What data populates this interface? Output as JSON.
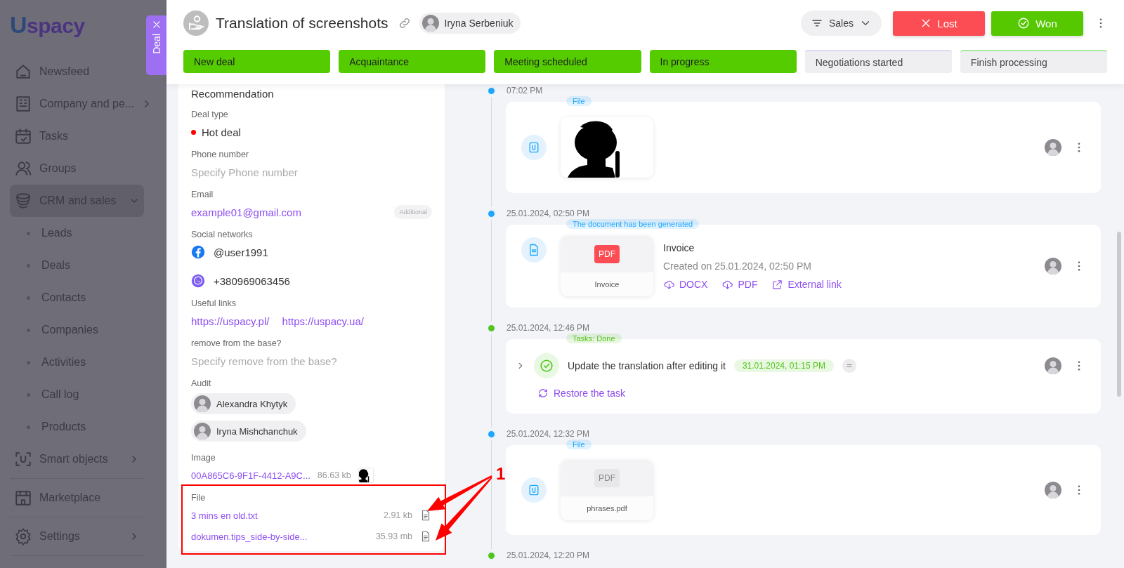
{
  "sidebar": {
    "logo": "Uspacy",
    "sections": [
      [
        {
          "label": "Newsfeed",
          "selected": false
        },
        {
          "label": "Company and pe...",
          "selected": false,
          "expanded": false
        },
        {
          "label": "Tasks",
          "selected": false
        },
        {
          "label": "Groups",
          "selected": false
        },
        {
          "label": "CRM and sales",
          "selected": true,
          "expanded": true,
          "children": [
            {
              "label": "Leads",
              "selected": false
            },
            {
              "label": "Deals",
              "selected": false
            },
            {
              "label": "Contacts",
              "selected": false
            },
            {
              "label": "Companies",
              "selected": false
            },
            {
              "label": "Activities",
              "selected": false
            },
            {
              "label": "Call log",
              "selected": false
            },
            {
              "label": "Products",
              "selected": false
            }
          ]
        },
        {
          "label": "Smart objects",
          "selected": false,
          "expanded": false
        }
      ],
      [
        {
          "label": "Marketplace",
          "selected": false
        }
      ],
      [
        {
          "label": "Settings",
          "selected": false,
          "expanded": false
        }
      ]
    ]
  },
  "deal_tab": {
    "label": "Deal"
  },
  "header": {
    "title": "Translation of screenshots",
    "owner": "Iryna Serbeniuk",
    "pipeline": "Sales",
    "lost_button": "Lost",
    "won_button": "Won"
  },
  "stages": [
    {
      "label": "New deal",
      "done": true,
      "color": "#55cc00"
    },
    {
      "label": "Acquaintance",
      "done": true,
      "color": "#55cc00"
    },
    {
      "label": "Meeting scheduled",
      "done": true,
      "color": "#55cc00"
    },
    {
      "label": "In progress",
      "done": true,
      "color": "#55cc00"
    },
    {
      "label": "Negotiations started",
      "done": false,
      "color": "#e2d6f7"
    },
    {
      "label": "Finish processing",
      "done": false,
      "color": "#a8e69c"
    }
  ],
  "fields": [
    {
      "kind": "value",
      "value": "Recommendation"
    },
    {
      "kind": "tag",
      "label": "Deal type",
      "value": "Hot deal",
      "color": "#ff0000"
    },
    {
      "kind": "empty",
      "label": "Phone number",
      "placeholder": "Specify Phone number"
    },
    {
      "kind": "email",
      "label": "Email",
      "value": "example01@gmail.com",
      "badge": "Additional"
    },
    {
      "kind": "social",
      "label": "Social networks",
      "entries": [
        {
          "kind": "facebook",
          "value": "@user1991"
        },
        {
          "kind": "viber",
          "value": "+380969063456"
        }
      ]
    },
    {
      "kind": "links",
      "label": "Useful links",
      "links": [
        "https://uspacy.pl/",
        "https://uspacy.ua/"
      ]
    },
    {
      "kind": "empty",
      "label": "remove from the base?",
      "placeholder": "Specify remove from the base?"
    },
    {
      "kind": "people",
      "label": "Audit",
      "people": [
        "Alexandra Khytyk",
        "Iryna Mishchanchuk"
      ]
    },
    {
      "label": "Image",
      "name": "00A865C6-9F1F-4412-A9C...",
      "size": "86.63 kb"
    },
    {
      "kind": "files",
      "label": "File",
      "files": [
        {
          "name": "3 mins en old.txt",
          "size": "2.91 kb"
        },
        {
          "name": "dokumen.tips_side-by-side...",
          "size": "35.93 mb"
        }
      ]
    }
  ],
  "annotation": {
    "label": "1"
  },
  "timeline": [
    {
      "time": "07:02 PM",
      "color": "#1ea7fd",
      "tag": "File"
    },
    {
      "kind": "document",
      "time": "25.01.2024, 02:50 PM",
      "color": "#1ea7fd",
      "tag": "The document has been generated",
      "thumb_badge": "PDF",
      "thumb_name": "Invoice",
      "title": "Invoice",
      "subtitle": "Created on 25.01.2024, 02:50 PM",
      "actions": [
        "DOCX",
        "PDF",
        "External link"
      ]
    },
    {
      "kind": "task",
      "time": "25.01.2024, 12:46 PM",
      "color": "#52c41a",
      "tag": "Tasks: Done",
      "expanded": false,
      "title": "Update the translation after editing it",
      "deadline": "31.01.2024, 01:15 PM",
      "action": "Restore the task"
    },
    {
      "kind": "file",
      "time": "25.01.2024, 12:32 PM",
      "color": "#1ea7fd",
      "tag": "File",
      "thumb_badge": "PDF",
      "thumb_name": "phrases.pdf"
    },
    {
      "kind": "stub",
      "time": "25.01.2024, 12:20 PM",
      "color": "#52c41a"
    }
  ]
}
